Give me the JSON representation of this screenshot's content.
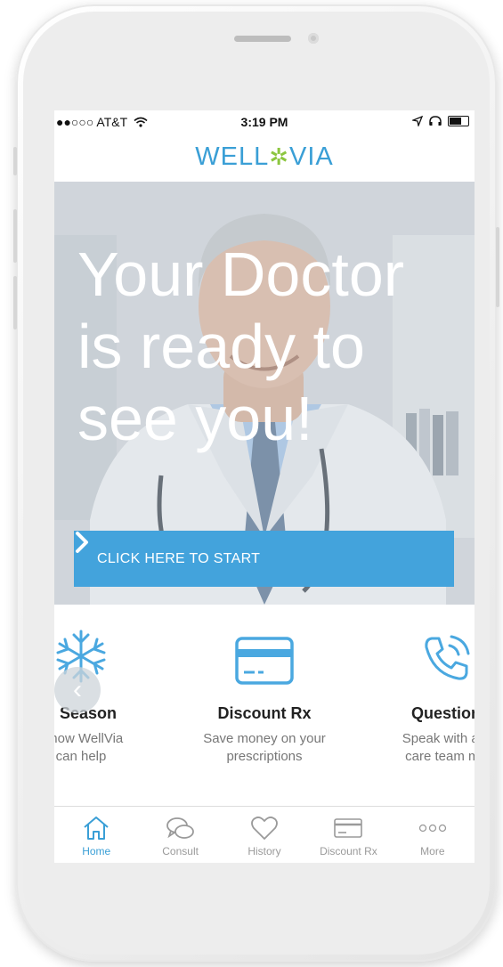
{
  "status_bar": {
    "carrier": "●●○○○ AT&T",
    "time": "3:19 PM",
    "battery_level": 0.7
  },
  "app": {
    "logo_left": "WELL",
    "logo_right": "VIA",
    "logo_mark": "✲"
  },
  "hero": {
    "line1": "Your Doctor",
    "line2": "is ready to",
    "line3": "see you!",
    "cta_label": "CLICK HERE TO START",
    "cta_icon": "chevron-right-icon"
  },
  "carousel": {
    "items": [
      {
        "title": "u Season",
        "desc1": "n how WellVia",
        "desc2": "can help",
        "icon": "snowflake-icon"
      },
      {
        "title": "Discount Rx",
        "desc1": "Save money on your",
        "desc2": "prescriptions",
        "icon": "card-icon"
      },
      {
        "title": "Question",
        "desc1": "Speak with a p",
        "desc2": "care team me",
        "icon": "phone-icon"
      }
    ],
    "prev_glyph": "‹"
  },
  "tabs": [
    {
      "label": "Home",
      "icon": "home-icon",
      "active": true
    },
    {
      "label": "Consult",
      "icon": "chat-icon",
      "active": false
    },
    {
      "label": "History",
      "icon": "heart-icon",
      "active": false
    },
    {
      "label": "Discount Rx",
      "icon": "card-icon",
      "active": false
    },
    {
      "label": "More",
      "icon": "more-icon",
      "active": false
    }
  ],
  "colors": {
    "accent": "#43a3dc",
    "logo_blue": "#3a9fd6",
    "logo_green": "#8cc63f",
    "tab_inactive": "#9a9a9a"
  }
}
